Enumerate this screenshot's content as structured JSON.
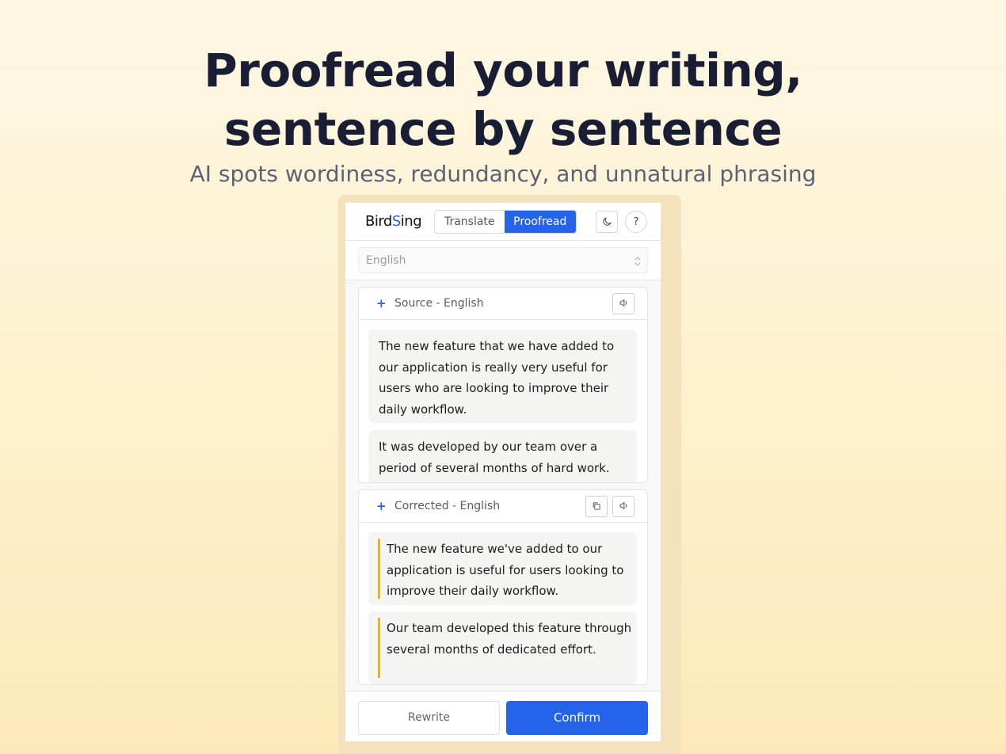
{
  "hero": {
    "title_line1": "Proofread your writing,",
    "title_line2": "sentence by sentence",
    "subtitle": "AI spots wordiness, redundancy, and unnatural phrasing"
  },
  "app": {
    "logo_prefix": "Bird",
    "logo_accent": "S",
    "logo_suffix": "ing",
    "modes": [
      {
        "label": "Translate",
        "active": false
      },
      {
        "label": "Proofread",
        "active": true
      }
    ],
    "theme_icon": "moon-icon",
    "help_label": "?"
  },
  "language_select": {
    "value": "English",
    "icon": "chevron-updown-icon"
  },
  "source": {
    "plus": "+",
    "title": "Source - English",
    "icons": [
      "speaker-icon"
    ],
    "sentences": [
      "The new feature that we have added to our application is really very useful for users who are looking to improve their daily workflow.",
      "It was developed by our team over a period of several months of hard work."
    ]
  },
  "corrected": {
    "plus": "+",
    "title": "Corrected - English",
    "icons": [
      "copy-icon",
      "speaker-icon"
    ],
    "sentences": [
      "The new feature we've added to our application is useful for users looking to improve their daily workflow.",
      "Our team developed this feature through several months of dedicated effort."
    ],
    "highlight_color": "#e9b21b"
  },
  "actions": {
    "rewrite_label": "Rewrite",
    "confirm_label": "Confirm"
  },
  "colors": {
    "accent": "#2563eb",
    "title": "#1a1e35",
    "subtitle": "#5d6175",
    "background_top": "#fdf7e3",
    "background_bottom": "#fde9b8"
  }
}
